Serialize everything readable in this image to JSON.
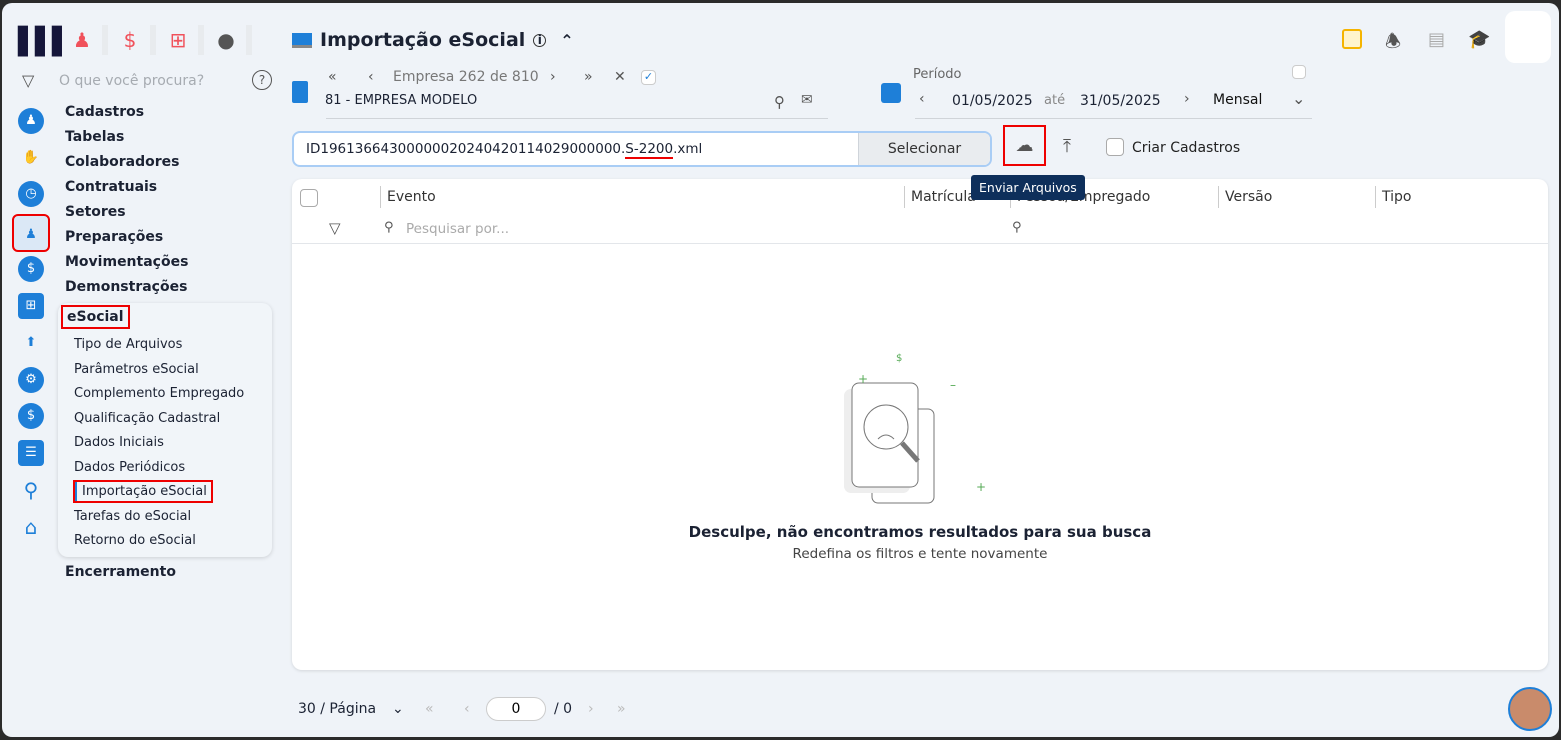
{
  "sidebar": {
    "search_placeholder": "O que você procura?",
    "menu": [
      "Cadastros",
      "Tabelas",
      "Colaboradores",
      "Contratuais",
      "Setores",
      "Preparações",
      "Movimentações",
      "Demonstrações"
    ],
    "esocial": {
      "label": "eSocial",
      "items": [
        "Tipo de Arquivos",
        "Parâmetros eSocial",
        "Complemento Empregado",
        "Qualificação Cadastral",
        "Dados Iniciais",
        "Dados Periódicos",
        "Importação eSocial",
        "Tarefas do eSocial",
        "Retorno do eSocial"
      ]
    },
    "after": "Encerramento"
  },
  "header": {
    "title": "Importação eSocial"
  },
  "company": {
    "nav_label": "Empresa",
    "current": "262",
    "of": "de",
    "total": "810",
    "name": "81 - EMPRESA MODELO"
  },
  "period": {
    "label": "Período",
    "from": "01/05/2025",
    "to_label": "até",
    "to": "31/05/2025",
    "mode": "Mensal"
  },
  "file": {
    "value_prefix": "ID19613664300000020240420114029000000.",
    "value_highlight": "S-2200",
    "value_suffix": ".xml",
    "select_label": "Selecionar",
    "create_label": "Criar Cadastros",
    "tooltip": "Enviar Arquivos"
  },
  "table": {
    "columns": [
      "Evento",
      "Matrícula",
      "Pessoa/Empregado",
      "Versão",
      "Tipo"
    ],
    "search_placeholder": "Pesquisar por...",
    "empty_title": "Desculpe, não encontramos resultados para sua busca",
    "empty_sub": "Redefina os filtros e tente novamente"
  },
  "pagination": {
    "per_page": "30 / Página",
    "page": "0",
    "total": "/ 0"
  },
  "colors": {
    "accent": "#1e7fd8",
    "highlight": "#e00000",
    "tooltip": "#0e2f5b"
  }
}
